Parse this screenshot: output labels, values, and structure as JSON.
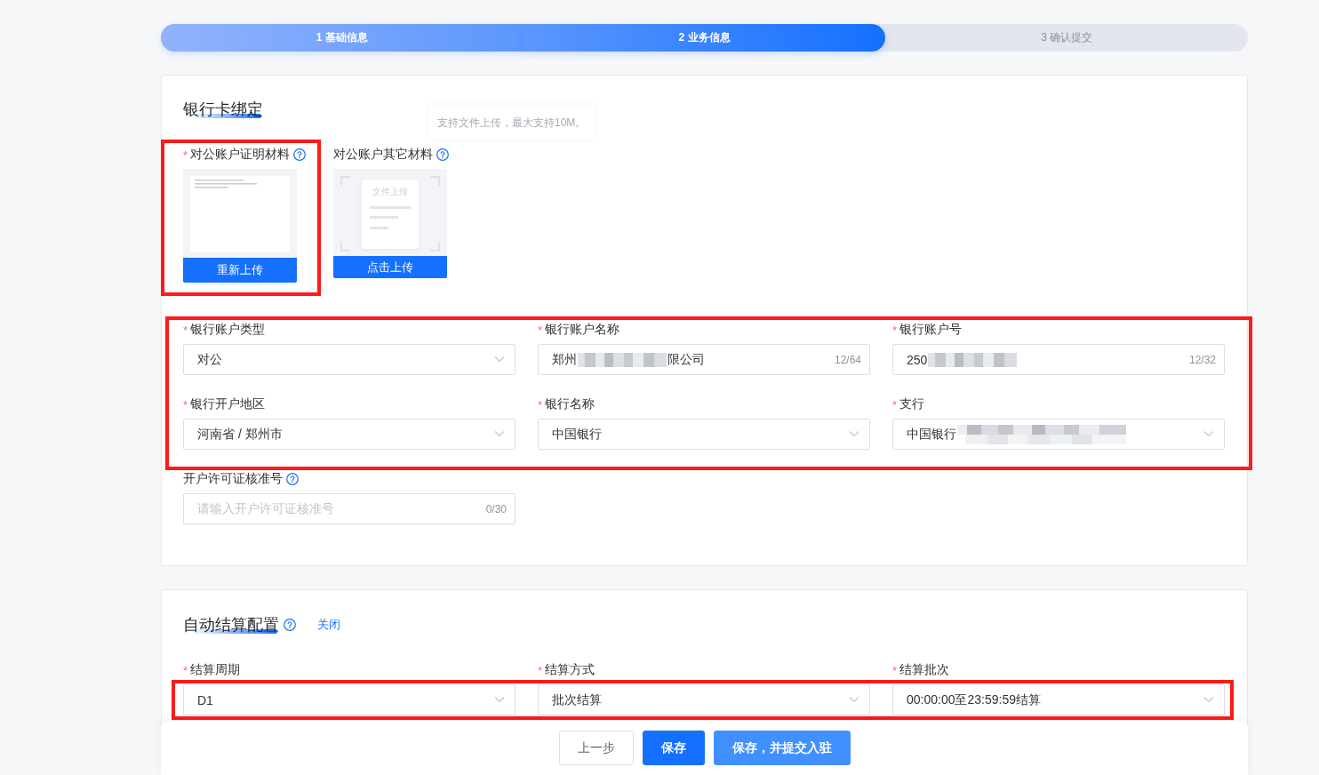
{
  "steps": [
    {
      "label": "1 基础信息",
      "completed": true,
      "selected": false
    },
    {
      "label": "2 业务信息",
      "completed": false,
      "selected": true
    },
    {
      "label": "3 确认提交",
      "completed": false,
      "selected": false
    }
  ],
  "bank_card": {
    "title": "银行卡绑定",
    "tooltip": "支持文件上传，最大支持10M。",
    "uploads": [
      {
        "label": "对公账户证明材料",
        "required_mark": "*",
        "help": true,
        "uploaded": true,
        "highlighted": true,
        "button": "重新上传"
      },
      {
        "label": "对公账户其它材料",
        "help": true,
        "uploaded": false,
        "highlighted": false,
        "placeholder": "文件上传",
        "button": "点击上传"
      }
    ],
    "field_groups": [
      {
        "highlighted": true,
        "fields": [
          {
            "kind": "select",
            "label": "银行账户类型",
            "required_mark": "*",
            "help": false,
            "value": "对公",
            "redacted": false
          },
          {
            "kind": "input",
            "label": "银行账户名称",
            "required_mark": "*",
            "help": false,
            "value": "郑州",
            "redacted": true,
            "value_tail": "限公司",
            "counter": "12/64"
          },
          {
            "kind": "input",
            "label": "银行账户号",
            "required_mark": "*",
            "help": false,
            "value": "250",
            "redacted": true,
            "counter": "12/32"
          },
          {
            "kind": "select",
            "label": "银行开户地区",
            "required_mark": "*",
            "help": false,
            "value": "河南省 / 郑州市",
            "redacted": false
          },
          {
            "kind": "select",
            "label": "银行名称",
            "required_mark": "*",
            "help": false,
            "value": "中国银行",
            "redacted": false
          },
          {
            "kind": "select",
            "label": "支行",
            "required_mark": "*",
            "help": false,
            "value": "中国银行",
            "redacted": true
          }
        ]
      },
      {
        "highlighted": false,
        "fields": [
          {
            "kind": "input",
            "label": "开户许可证核准号",
            "help": true,
            "placeholder": "请输入开户许可证核准号",
            "redacted": false,
            "counter": "0/30"
          }
        ]
      }
    ]
  },
  "auto_settlement": {
    "title": "自动结算配置",
    "help": true,
    "link": "关闭",
    "highlighted": true,
    "fields": [
      {
        "kind": "select",
        "label": "结算周期",
        "required_mark": "*",
        "help": false,
        "value": "D1",
        "redacted": false
      },
      {
        "kind": "select",
        "label": "结算方式",
        "required_mark": "*",
        "help": false,
        "value": "批次结算",
        "redacted": false
      },
      {
        "kind": "select",
        "label": "结算批次",
        "required_mark": "*",
        "help": false,
        "value": "00:00:00至23:59:59结算",
        "redacted": false
      }
    ]
  },
  "footer": {
    "buttons": [
      {
        "label": "上一步",
        "kind": "default"
      },
      {
        "label": "保存",
        "kind": "primary"
      },
      {
        "label": "保存，并提交入驻",
        "kind": "secondary"
      }
    ]
  }
}
